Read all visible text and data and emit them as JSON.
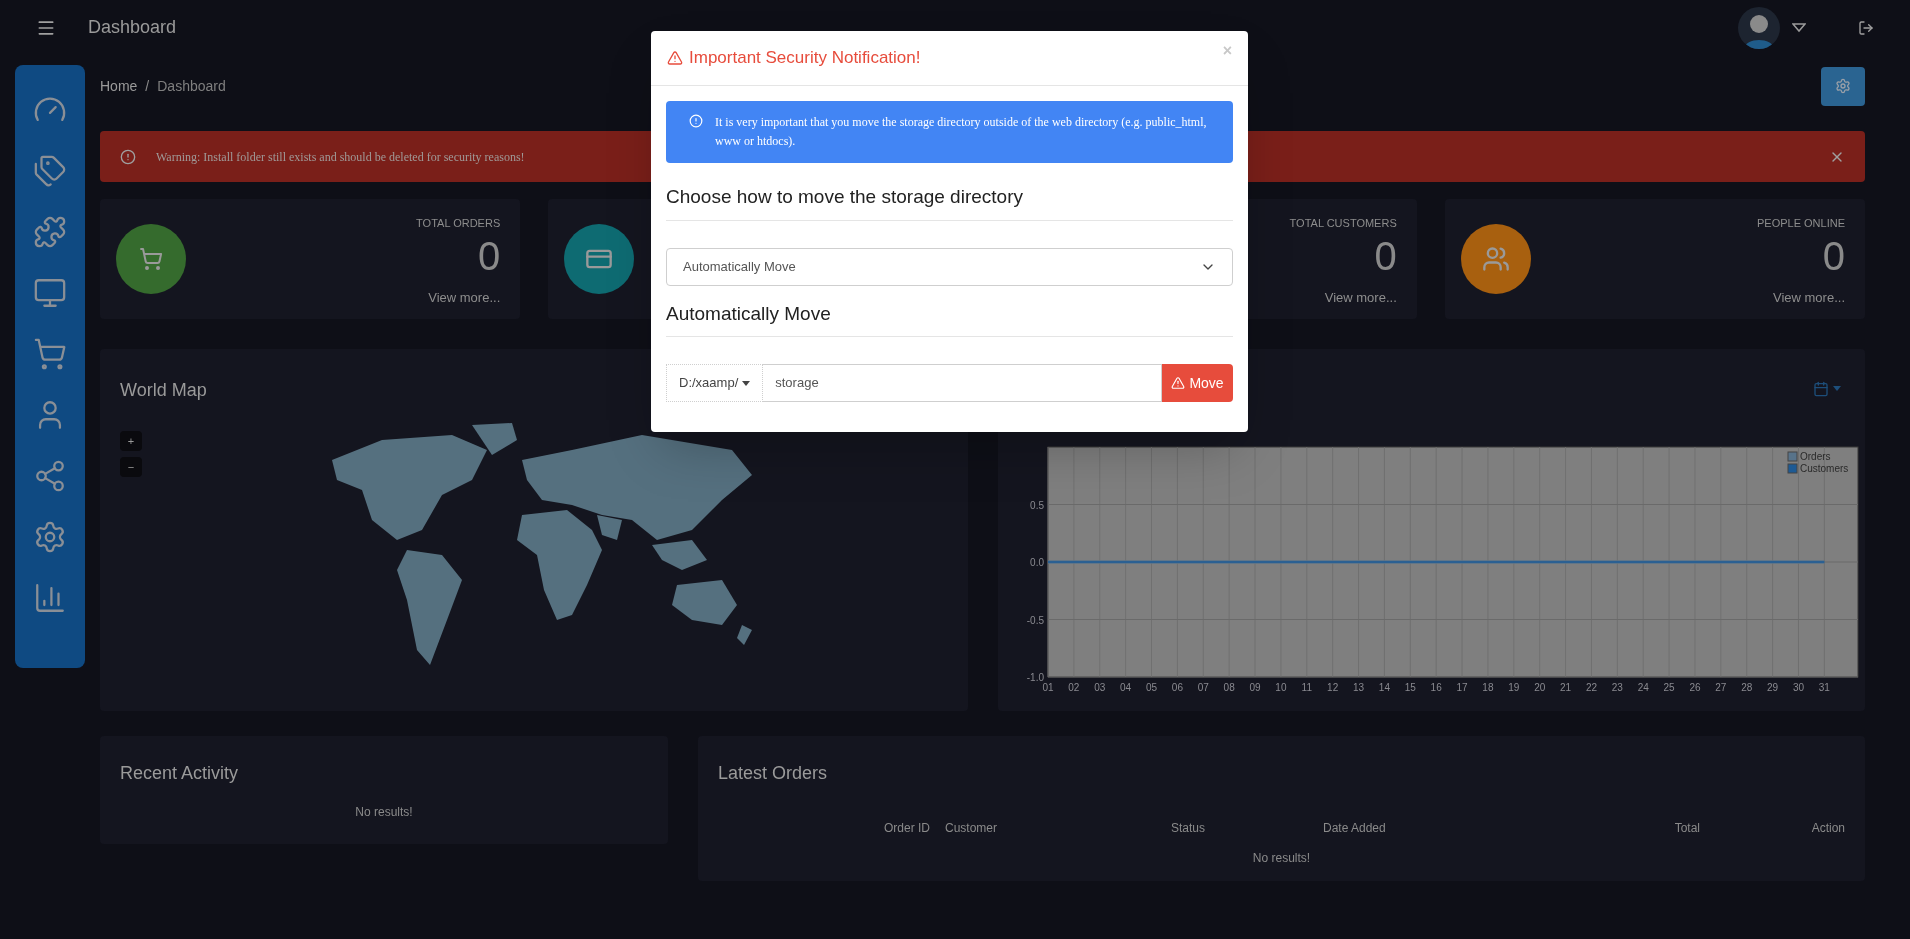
{
  "topbar": {
    "title": "Dashboard"
  },
  "breadcrumb": {
    "items": [
      "Home",
      "Dashboard"
    ],
    "separator": "/"
  },
  "alert": {
    "text": "Warning: Install folder still exists and should be deleted for security reasons!"
  },
  "stats": [
    {
      "kind": "cart",
      "color": "#356b2d",
      "title": "TOTAL ORDERS",
      "value": "0",
      "link": "View more..."
    },
    {
      "kind": "card",
      "color": "#0e6b72"
    },
    {
      "title": "TOTAL CUSTOMERS",
      "value": "0",
      "link": "View more..."
    },
    {
      "kind": "people",
      "color": "#a8600f",
      "title": "PEOPLE ONLINE",
      "value": "0",
      "link": "View more..."
    }
  ],
  "world_map": {
    "title": "World Map",
    "zoom_in": "+",
    "zoom_out": "−"
  },
  "sales_chart": {
    "chart_data": {
      "type": "line",
      "categories": [
        "01",
        "02",
        "03",
        "04",
        "05",
        "06",
        "07",
        "08",
        "09",
        "10",
        "11",
        "12",
        "13",
        "14",
        "15",
        "16",
        "17",
        "18",
        "19",
        "20",
        "21",
        "22",
        "23",
        "24",
        "25",
        "26",
        "27",
        "28",
        "29",
        "30",
        "31"
      ],
      "ylim": [
        -1,
        1
      ],
      "yticks": [
        {
          "value": -1,
          "label": "-1.0"
        },
        -0.5,
        {
          "value": 0,
          "label": "0.0"
        },
        0.5
      ],
      "grid": true,
      "legend": true,
      "series": [
        {
          "name": "Orders",
          "color": "#58738a",
          "values": [
            0,
            0,
            0,
            0,
            0,
            0,
            0,
            0,
            0,
            0,
            0,
            0,
            0,
            0,
            0,
            0,
            0,
            0,
            0,
            0,
            0,
            0,
            0,
            0,
            0,
            0,
            0,
            0,
            0,
            0,
            0
          ]
        },
        {
          "name": "Customers",
          "color": "#1d5a94",
          "values": [
            0,
            0,
            0,
            0,
            0,
            0,
            0,
            0,
            0,
            0,
            0,
            0,
            0,
            0,
            0,
            0,
            0,
            0,
            0,
            0,
            0,
            0,
            0,
            0,
            0,
            0,
            0,
            0,
            0,
            0,
            0
          ]
        }
      ]
    }
  },
  "recent_activity": {
    "title": "Recent Activity",
    "empty": "No results!"
  },
  "latest_orders": {
    "title": "Latest Orders",
    "columns": [
      "Order ID",
      "Customer",
      "Status",
      "Date Added",
      "Total",
      "Action"
    ],
    "empty": "No results!"
  },
  "modal": {
    "title": "Important Security Notification!",
    "close": "×",
    "info": "It is very important that you move the storage directory outside of the web directory (e.g. public_html, www or htdocs).",
    "heading_1": "Choose how to move the storage directory",
    "select_value": "Automatically Move",
    "heading_2": "Automatically Move",
    "path_prefix": "D:/xaamp/",
    "input_value": "storage",
    "button": "Move"
  }
}
